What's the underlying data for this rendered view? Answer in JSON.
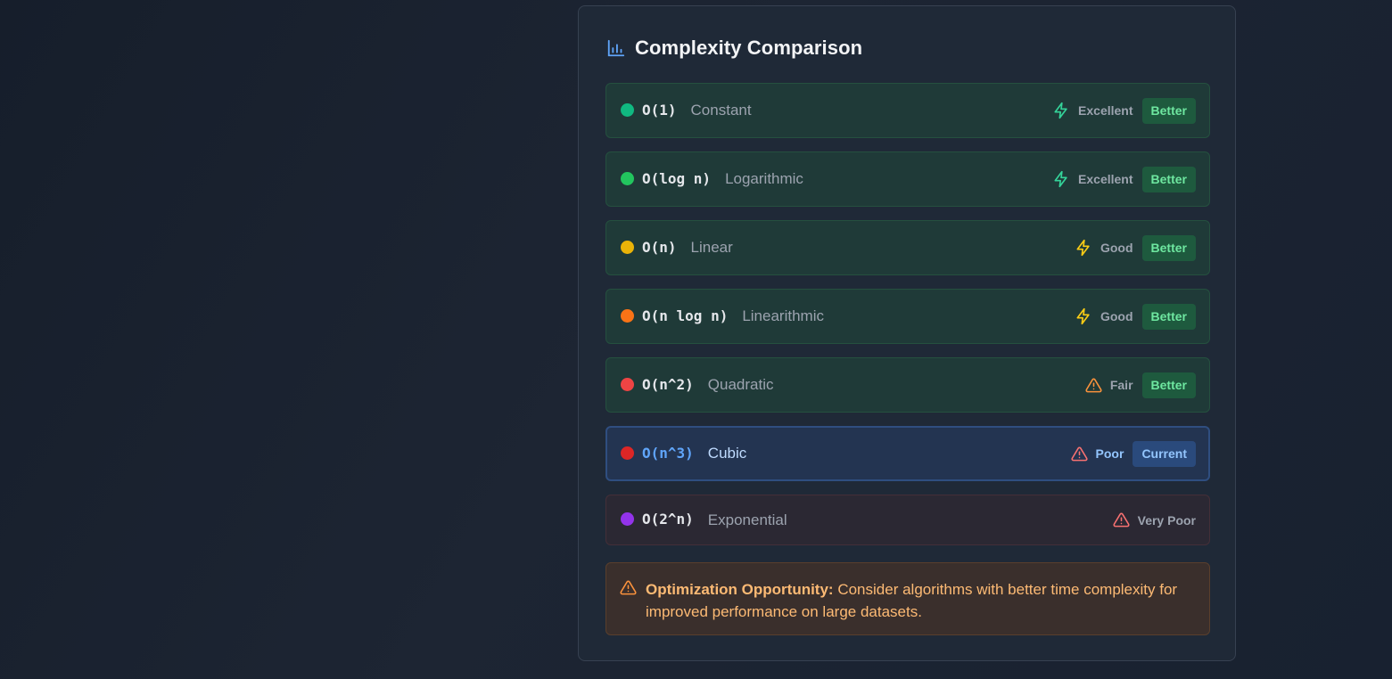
{
  "panel": {
    "title": "Complexity Comparison",
    "icon": "bar-chart-icon"
  },
  "rows": [
    {
      "notation": "O(1)",
      "name": "Constant",
      "rating": "Excellent",
      "rating_icon": "lightning-icon",
      "badge": "Better",
      "state": "better",
      "dot_color": "#10b981",
      "icon_color": "#34d399"
    },
    {
      "notation": "O(log n)",
      "name": "Logarithmic",
      "rating": "Excellent",
      "rating_icon": "lightning-icon",
      "badge": "Better",
      "state": "better",
      "dot_color": "#22c55e",
      "icon_color": "#34d399"
    },
    {
      "notation": "O(n)",
      "name": "Linear",
      "rating": "Good",
      "rating_icon": "lightning-icon",
      "badge": "Better",
      "state": "better",
      "dot_color": "#eab308",
      "icon_color": "#facc15"
    },
    {
      "notation": "O(n log n)",
      "name": "Linearithmic",
      "rating": "Good",
      "rating_icon": "lightning-icon",
      "badge": "Better",
      "state": "better",
      "dot_color": "#f97316",
      "icon_color": "#facc15"
    },
    {
      "notation": "O(n^2)",
      "name": "Quadratic",
      "rating": "Fair",
      "rating_icon": "warning-triangle-icon",
      "badge": "Better",
      "state": "better",
      "dot_color": "#ef4444",
      "icon_color": "#fb923c"
    },
    {
      "notation": "O(n^3)",
      "name": "Cubic",
      "rating": "Poor",
      "rating_icon": "warning-triangle-icon",
      "badge": "Current",
      "state": "current",
      "dot_color": "#dc2626",
      "icon_color": "#f87171"
    },
    {
      "notation": "O(2^n)",
      "name": "Exponential",
      "rating": "Very Poor",
      "rating_icon": "warning-triangle-icon",
      "badge": "",
      "state": "worse",
      "dot_color": "#9333ea",
      "icon_color": "#f87171"
    }
  ],
  "warning": {
    "icon": "warning-triangle-icon",
    "title": "Optimization Opportunity:",
    "message": "Consider algorithms with better time complexity for improved performance on large datasets.",
    "color": "#fb923c"
  }
}
